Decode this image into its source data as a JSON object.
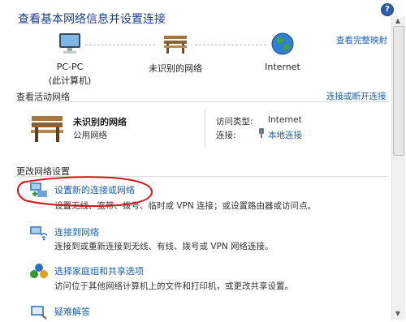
{
  "header": {
    "title": "查看基本网络信息并设置连接",
    "view_full_map": "查看完整映射"
  },
  "map": {
    "pc_label": "PC-PC",
    "pc_sublabel": "(此计算机)",
    "network_label": "未识别的网络",
    "internet_label": "Internet"
  },
  "active_networks": {
    "heading": "查看活动网络",
    "connect_disconnect": "连接或断开连接",
    "network_name": "未识别的网络",
    "network_type": "公用网络",
    "access_type_label": "访问类型:",
    "access_type_value": "Internet",
    "connections_label": "连接:",
    "connection_value": "本地连接"
  },
  "change_settings": {
    "heading": "更改网络设置",
    "items": [
      {
        "label": "设置新的连接或网络",
        "desc": "设置无线、宽带、拨号、临时或 VPN 连接；或设置路由器或访问点。"
      },
      {
        "label": "连接到网络",
        "desc": "连接到或重新连接到无线、有线、拨号或 VPN 网络连接。"
      },
      {
        "label": "选择家庭组和共享选项",
        "desc": "访问位于其他网络计算机上的文件和打印机，或更改共享设置。"
      },
      {
        "label": "疑难解答",
        "desc": ""
      }
    ]
  },
  "colors": {
    "link": "#1a5fb4",
    "title": "#1a3f8f",
    "annotation": "#d9141c"
  }
}
